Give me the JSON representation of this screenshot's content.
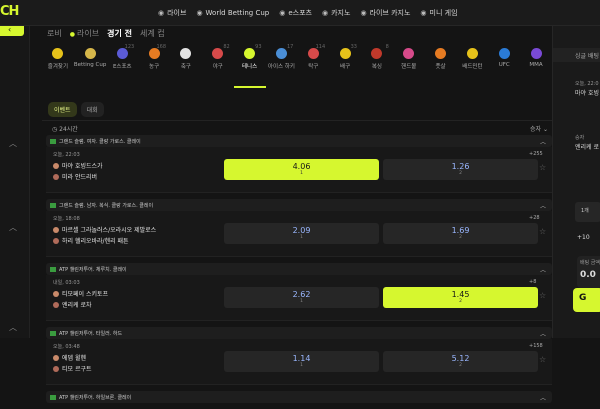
{
  "logo": {
    "text": "CH"
  },
  "topnav": [
    {
      "label": "라이브",
      "icon": "live-icon"
    },
    {
      "label": "World Betting Cup",
      "icon": "trophy-icon"
    },
    {
      "label": "e스포츠",
      "icon": "gamepad-icon"
    },
    {
      "label": "카지노",
      "icon": "cards-icon"
    },
    {
      "label": "라이브 카지노",
      "icon": "chip-icon"
    },
    {
      "label": "미니 게임",
      "icon": "wand-icon"
    }
  ],
  "tabs": [
    "로비",
    "라이브",
    "경기 전",
    "세계 컵"
  ],
  "sports": [
    {
      "label": "즐겨찾기",
      "count": "",
      "color": "#e6c21a"
    },
    {
      "label": "Betting Cup",
      "count": "",
      "color": "#d6b74a"
    },
    {
      "label": "E스포츠",
      "count": "123",
      "color": "#5b5bd6"
    },
    {
      "label": "농구",
      "count": "168",
      "color": "#e67b22"
    },
    {
      "label": "축구",
      "count": "",
      "color": "#e2e2e2"
    },
    {
      "label": "야구",
      "count": "82",
      "color": "#d64a4a"
    },
    {
      "label": "테니스",
      "count": "93",
      "color": "#d6f72f"
    },
    {
      "label": "아이스 하키",
      "count": "17",
      "color": "#4a8ed6"
    },
    {
      "label": "탁구",
      "count": "114",
      "color": "#d64a4a"
    },
    {
      "label": "배구",
      "count": "33",
      "color": "#e6c21a"
    },
    {
      "label": "복싱",
      "count": "8",
      "color": "#c0392b"
    },
    {
      "label": "핸드볼",
      "count": "",
      "color": "#d64a8a"
    },
    {
      "label": "풋살",
      "count": "",
      "color": "#e67b22"
    },
    {
      "label": "배드민턴",
      "count": "",
      "color": "#e6c21a"
    },
    {
      "label": "UFC",
      "count": "",
      "color": "#2a7bd6"
    },
    {
      "label": "MMA",
      "count": "",
      "color": "#7a4ad6"
    }
  ],
  "filters": [
    "이벤트",
    "대회"
  ],
  "timebar": {
    "left": "24시간",
    "right": "승자"
  },
  "leagues": [
    {
      "name": "그랜드 슬램. 여자. 클랑 가로스. 클레이",
      "match": {
        "time": "오늘, 22:03",
        "more": "+255",
        "team1": "마야 호빙드스가",
        "team2": "미라 안드리버",
        "odd1": "4.06",
        "odd2": "1.26",
        "sel": 1
      }
    },
    {
      "name": "그랜드 슬램. 남자. 복식. 클랑 가로스. 클레이",
      "match": {
        "time": "오늘, 18:08",
        "more": "+28",
        "team1": "마르셀 그라놀러스/오라시오 제발로스",
        "team2": "하리 헬리오바라/헨리 패튼",
        "odd1": "2.09",
        "odd2": "1.69",
        "sel": 0
      }
    },
    {
      "name": "ATP 챌린저투어. 체루치. 클레이",
      "match": {
        "time": "내일, 03:03",
        "more": "+8",
        "team1": "티모페이 스키토프",
        "team2": "엔리케 로차",
        "odd1": "2.62",
        "odd2": "1.45",
        "sel": 2
      }
    },
    {
      "name": "ATP 챌린저투어. 타일러. 하드",
      "match": {
        "time": "오늘, 03:48",
        "more": "+158",
        "team1": "에뎀 윌헨",
        "team2": "티모 르구트",
        "odd1": "1.14",
        "odd2": "5.12",
        "sel": 0
      }
    },
    {
      "name": "ATP 챌린저투어. 하일브론. 클레이",
      "match": null
    }
  ],
  "oddNums": [
    "1",
    "2"
  ],
  "rightPanel": {
    "head": "싱글 배팅",
    "c1": {
      "small": "오늘, 22:0",
      "name": "마야 호빙"
    },
    "c2": {
      "small": "승자",
      "name": "엔리케 로"
    },
    "badge": "1개",
    "amt": "+10",
    "box_label": "배팅 금액",
    "box_value": "0.0",
    "btn": "G"
  }
}
